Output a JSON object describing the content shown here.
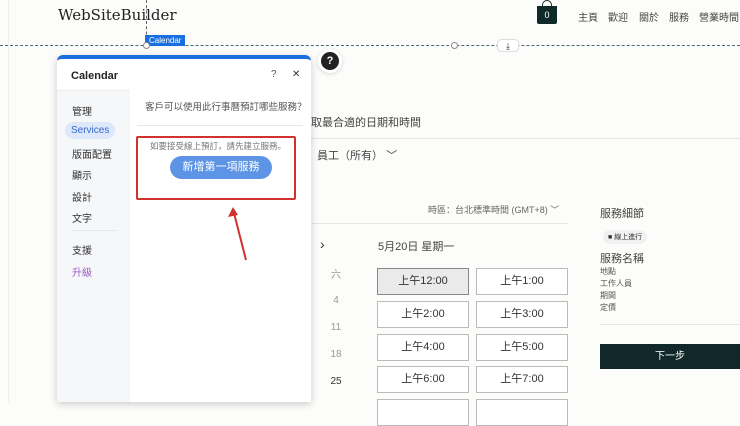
{
  "site": {
    "logo": "WebSiteBuilder",
    "cart_count": "0",
    "nav": [
      "主頁",
      "歡迎",
      "關於",
      "服務",
      "營業時間"
    ]
  },
  "editor": {
    "element_tag": "Calendar",
    "help_icon": "?",
    "download_icon": "⤓"
  },
  "booking": {
    "heading": "選取最合適的日期和時間",
    "staff_filter": "員工（所有）",
    "timezone": "時區：台北標準時間 (GMT+8)",
    "date": "5月20日 星期一",
    "weekday": "六",
    "days": [
      "4",
      "11",
      "18",
      "25"
    ],
    "slots": [
      "上午12:00",
      "上午1:00",
      "上午2:00",
      "上午3:00",
      "上午4:00",
      "上午5:00",
      "上午6:00",
      "上午7:00"
    ],
    "details": {
      "title": "服務細節",
      "online": "線上進行",
      "service_name": "服務名稱",
      "items": [
        "地點",
        "工作人員",
        "期間",
        "定價"
      ],
      "next": "下一步"
    }
  },
  "panel": {
    "title": "Calendar",
    "help": "?",
    "close": "✕",
    "menu": [
      "管理",
      "Services",
      "版面配置",
      "顯示",
      "設計",
      "文字",
      "支援",
      "升級"
    ],
    "question": "客戶可以使用此行事曆預訂哪些服務？",
    "hint": "如要接受線上預訂，請先建立服務。",
    "add_button": "新增第一項服務"
  }
}
